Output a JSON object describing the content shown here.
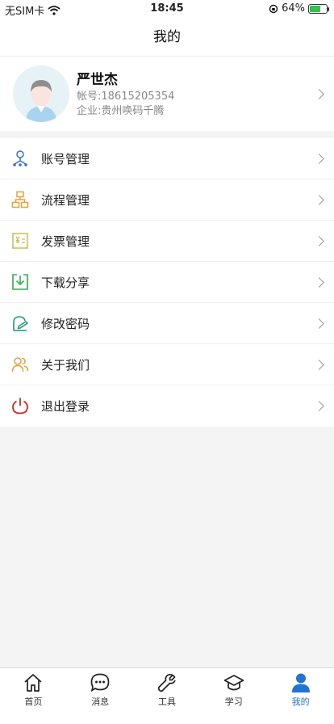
{
  "status_bar": {
    "carrier": "无SIM卡",
    "time": "18:45",
    "battery_percent": "64%",
    "battery_level": 0.64
  },
  "nav": {
    "title": "我的"
  },
  "profile": {
    "name": "严世杰",
    "account": "帐号:18615205354",
    "company": "企业:贵州唤码千腾"
  },
  "menu": [
    {
      "label": "账号管理",
      "icon": "account-tree-icon",
      "color": "#3a6fd8"
    },
    {
      "label": "流程管理",
      "icon": "process-icon",
      "color": "#e8a13a"
    },
    {
      "label": "发票管理",
      "icon": "invoice-icon",
      "color": "#d4b84a"
    },
    {
      "label": "下载分享",
      "icon": "download-icon",
      "color": "#2fb24a"
    },
    {
      "label": "修改密码",
      "icon": "edit-password-icon",
      "color": "#1f9a7a"
    },
    {
      "label": "关于我们",
      "icon": "about-us-icon",
      "color": "#e8a13a"
    },
    {
      "label": "退出登录",
      "icon": "power-icon",
      "color": "#d8271f"
    }
  ],
  "tabs": [
    {
      "label": "首页",
      "icon": "home-icon"
    },
    {
      "label": "消息",
      "icon": "message-icon"
    },
    {
      "label": "工具",
      "icon": "tools-icon"
    },
    {
      "label": "学习",
      "icon": "graduation-cap-icon"
    },
    {
      "label": "我的",
      "icon": "user-icon",
      "active": true
    }
  ],
  "colors": {
    "accent": "#1f74d6",
    "background": "#f4f4f4"
  }
}
